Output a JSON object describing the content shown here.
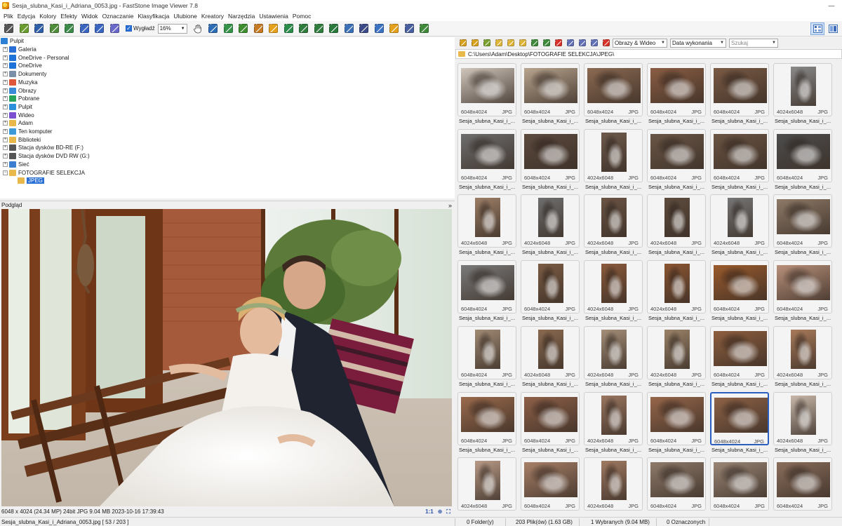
{
  "window": {
    "title": "Sesja_slubna_Kasi_i_Adriana_0053.jpg - FastStone Image Viewer 7.8",
    "minimize": "—"
  },
  "menu": [
    "Plik",
    "Edycja",
    "Kolory",
    "Efekty",
    "Widok",
    "Oznaczanie",
    "Klasyfikacja",
    "Ulubione",
    "Kreatory",
    "Narzędzia",
    "Ustawienia",
    "Pomoc"
  ],
  "toolbar": {
    "smooth_label": "Wygładź",
    "zoom_value": "16%"
  },
  "tree": {
    "items": [
      {
        "label": "Pulpit",
        "level": 0,
        "icon": "desktop-icon",
        "color": "#2b7fd4"
      },
      {
        "label": "Galeria",
        "level": 1,
        "icon": "gallery-icon",
        "color": "#2a6fd6"
      },
      {
        "label": "OneDrive - Personal",
        "level": 1,
        "icon": "cloud-icon",
        "color": "#1e73d8"
      },
      {
        "label": "OneDrive",
        "level": 1,
        "icon": "cloud-icon",
        "color": "#1e73d8"
      },
      {
        "label": "Dokumenty",
        "level": 1,
        "icon": "documents-icon",
        "color": "#7b8fa8"
      },
      {
        "label": "Muzyka",
        "level": 1,
        "icon": "music-icon",
        "color": "#e0563a"
      },
      {
        "label": "Obrazy",
        "level": 1,
        "icon": "pictures-icon",
        "color": "#3b8ad8"
      },
      {
        "label": "Pobrane",
        "level": 1,
        "icon": "download-icon",
        "color": "#27a35a"
      },
      {
        "label": "Pulpit",
        "level": 1,
        "icon": "desktop-icon",
        "color": "#2b90d9"
      },
      {
        "label": "Wideo",
        "level": 1,
        "icon": "video-icon",
        "color": "#7a4fd0"
      },
      {
        "label": "Adam",
        "level": 1,
        "icon": "folder-icon",
        "color": "#e9b84a"
      },
      {
        "label": "Ten komputer",
        "level": 1,
        "icon": "computer-icon",
        "color": "#3c9ad8"
      },
      {
        "label": "Biblioteki",
        "level": 1,
        "icon": "folder-icon",
        "color": "#e9b84a"
      },
      {
        "label": "Stacja dysków BD-RE (F:)",
        "level": 1,
        "icon": "disc-drive-icon",
        "color": "#555555"
      },
      {
        "label": "Stacja dysków DVD RW (G:)",
        "level": 1,
        "icon": "disc-drive-icon",
        "color": "#555555"
      },
      {
        "label": "Sieć",
        "level": 1,
        "icon": "network-icon",
        "color": "#3c7fd0"
      },
      {
        "label": "FOTOGRAFIE SELEKCJA",
        "level": 1,
        "icon": "folder-icon",
        "color": "#e9b84a"
      },
      {
        "label": "JPEG",
        "level": 2,
        "icon": "folder-icon",
        "color": "#e9b84a",
        "selected": true
      }
    ]
  },
  "preview": {
    "header": "Podgląd",
    "collapse": "»",
    "info": "6048 x 4024 (24.34 MP)  24bit  JPG  9.04 MB   2023-10-16 17:39:43",
    "ratio": "1:1"
  },
  "browser": {
    "filter": "Obrazy & Wideo",
    "sort": "Data wykonania",
    "search_placeholder": "Szukaj",
    "path": "C:\\Users\\Adam\\Desktop\\FOTOGRAFIE SELEKCJA\\JPEG\\"
  },
  "thumb_name": "Sesja_slubna_Kasi_i_...",
  "thumbnails": [
    {
      "dims": "6048x4024",
      "fmt": "JPG",
      "tone": "#cfc6bc",
      "orient": "landscape"
    },
    {
      "dims": "6048x4024",
      "fmt": "JPG",
      "tone": "#b9a58f",
      "orient": "landscape"
    },
    {
      "dims": "6048x4024",
      "fmt": "JPG",
      "tone": "#8c6a52",
      "orient": "landscape"
    },
    {
      "dims": "6048x4024",
      "fmt": "JPG",
      "tone": "#8a5d43",
      "orient": "landscape"
    },
    {
      "dims": "6048x4024",
      "fmt": "JPG",
      "tone": "#7a5a44",
      "orient": "landscape"
    },
    {
      "dims": "4024x6048",
      "fmt": "JPG",
      "tone": "#8a8a8a",
      "orient": "portrait"
    },
    {
      "dims": "6048x4024",
      "fmt": "JPG",
      "tone": "#6e6e6e",
      "orient": "landscape"
    },
    {
      "dims": "6048x4024",
      "fmt": "JPG",
      "tone": "#5c4a3e",
      "orient": "landscape"
    },
    {
      "dims": "4024x6048",
      "fmt": "JPG",
      "tone": "#6d5a4c",
      "orient": "portrait"
    },
    {
      "dims": "6048x4024",
      "fmt": "JPG",
      "tone": "#6a5646",
      "orient": "landscape"
    },
    {
      "dims": "6048x4024",
      "fmt": "JPG",
      "tone": "#6b5443",
      "orient": "landscape"
    },
    {
      "dims": "6048x4024",
      "fmt": "JPG",
      "tone": "#4d4d4d",
      "orient": "landscape"
    },
    {
      "dims": "4024x6048",
      "fmt": "JPG",
      "tone": "#9c7e66",
      "orient": "portrait"
    },
    {
      "dims": "4024x6048",
      "fmt": "JPG",
      "tone": "#6f6f6f",
      "orient": "portrait"
    },
    {
      "dims": "4024x6048",
      "fmt": "JPG",
      "tone": "#6a5444",
      "orient": "portrait"
    },
    {
      "dims": "4024x6048",
      "fmt": "JPG",
      "tone": "#5e4c3e",
      "orient": "portrait"
    },
    {
      "dims": "4024x6048",
      "fmt": "JPG",
      "tone": "#767676",
      "orient": "portrait"
    },
    {
      "dims": "6048x4024",
      "fmt": "JPG",
      "tone": "#8e7a68",
      "orient": "landscape"
    },
    {
      "dims": "6048x4024",
      "fmt": "JPG",
      "tone": "#7a7a7a",
      "orient": "landscape"
    },
    {
      "dims": "6048x4024",
      "fmt": "JPG",
      "tone": "#7b5c44",
      "orient": "portrait"
    },
    {
      "dims": "4024x6048",
      "fmt": "JPG",
      "tone": "#8a5a3c",
      "orient": "portrait"
    },
    {
      "dims": "4024x6048",
      "fmt": "JPG",
      "tone": "#8a5532",
      "orient": "portrait"
    },
    {
      "dims": "6048x4024",
      "fmt": "JPG",
      "tone": "#9a5a2c",
      "orient": "landscape"
    },
    {
      "dims": "6048x4024",
      "fmt": "JPG",
      "tone": "#b8907a",
      "orient": "landscape"
    },
    {
      "dims": "6048x4024",
      "fmt": "JPG",
      "tone": "#a08a74",
      "orient": "portrait"
    },
    {
      "dims": "4024x6048",
      "fmt": "JPG",
      "tone": "#8a6a50",
      "orient": "portrait"
    },
    {
      "dims": "4024x6048",
      "fmt": "JPG",
      "tone": "#a48e78",
      "orient": "portrait"
    },
    {
      "dims": "4024x6048",
      "fmt": "JPG",
      "tone": "#9a8268",
      "orient": "portrait"
    },
    {
      "dims": "6048x4024",
      "fmt": "JPG",
      "tone": "#8e5e3e",
      "orient": "landscape"
    },
    {
      "dims": "4024x6048",
      "fmt": "JPG",
      "tone": "#a87a5a",
      "orient": "portrait"
    },
    {
      "dims": "6048x4024",
      "fmt": "JPG",
      "tone": "#9a6a4c",
      "orient": "landscape"
    },
    {
      "dims": "6048x4024",
      "fmt": "JPG",
      "tone": "#8e6048",
      "orient": "landscape"
    },
    {
      "dims": "4024x6048",
      "fmt": "JPG",
      "tone": "#9a7660",
      "orient": "portrait"
    },
    {
      "dims": "6048x4024",
      "fmt": "JPG",
      "tone": "#96664a",
      "orient": "landscape"
    },
    {
      "dims": "6048x4024",
      "fmt": "JPG",
      "tone": "#8e6246",
      "orient": "landscape",
      "selected": true
    },
    {
      "dims": "4024x6048",
      "fmt": "JPG",
      "tone": "#c8b8aa",
      "orient": "portrait"
    },
    {
      "dims": "4024x6048",
      "fmt": "JPG",
      "tone": "#b89a86",
      "orient": "portrait"
    },
    {
      "dims": "6048x4024",
      "fmt": "JPG",
      "tone": "#a88068",
      "orient": "landscape"
    },
    {
      "dims": "4024x6048",
      "fmt": "JPG",
      "tone": "#a07a62",
      "orient": "portrait"
    },
    {
      "dims": "6048x4024",
      "fmt": "JPG",
      "tone": "#8e7a6a",
      "orient": "landscape"
    },
    {
      "dims": "6048x4024",
      "fmt": "JPG",
      "tone": "#9a8676",
      "orient": "landscape"
    },
    {
      "dims": "6048x4024",
      "fmt": "JPG",
      "tone": "#8a6e5c",
      "orient": "landscape"
    }
  ],
  "status": {
    "file": "Sesja_slubna_Kasi_i_Adriana_0053.jpg [ 53 / 203 ]",
    "folders": "0 Folder(y)",
    "files": "203 Plik(ów) (1.63 GB)",
    "selected": "1 Wybranych (9.04 MB)",
    "marked": "0 Oznaczonych"
  }
}
